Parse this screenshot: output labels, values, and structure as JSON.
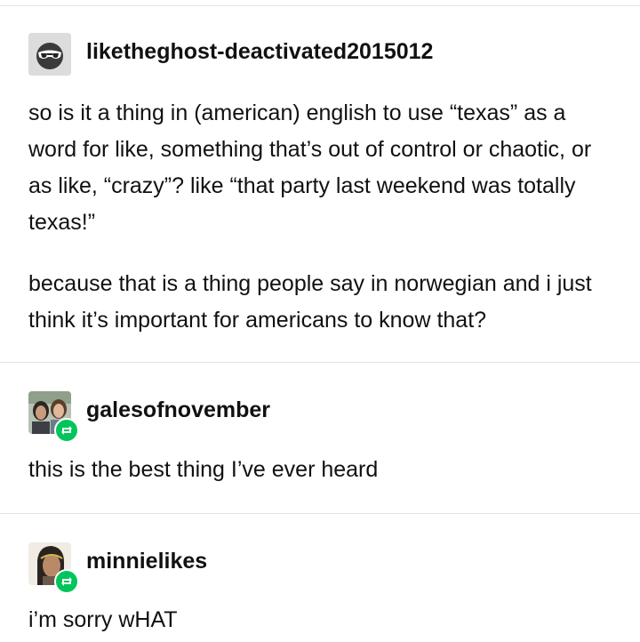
{
  "posts": [
    {
      "username": "liketheghost-deactivated2015012",
      "paragraphs": [
        "so is it a thing in (american) english to use “texas” as a word for like, something that’s out of control or chaotic, or as like, “crazy”? like “that party last weekend was totally texas!”",
        "because that is a thing people say in norwegian and i just think it’s important for americans to know that?"
      ]
    },
    {
      "username": "galesofnovember",
      "paragraphs": [
        "this is the best thing I’ve ever heard"
      ]
    },
    {
      "username": "minnielikes",
      "paragraphs": [
        "i’m sorry wHAT"
      ]
    }
  ],
  "colors": {
    "reblog_badge": "#00c55b",
    "divider": "#e3e3e3",
    "text": "#111111"
  },
  "icons": {
    "avatar_1": "sunglasses-logo-avatar",
    "avatar_2": "two-person-photo-avatar",
    "avatar_3": "illustrated-portrait-avatar",
    "reblog": "reblog-icon"
  }
}
